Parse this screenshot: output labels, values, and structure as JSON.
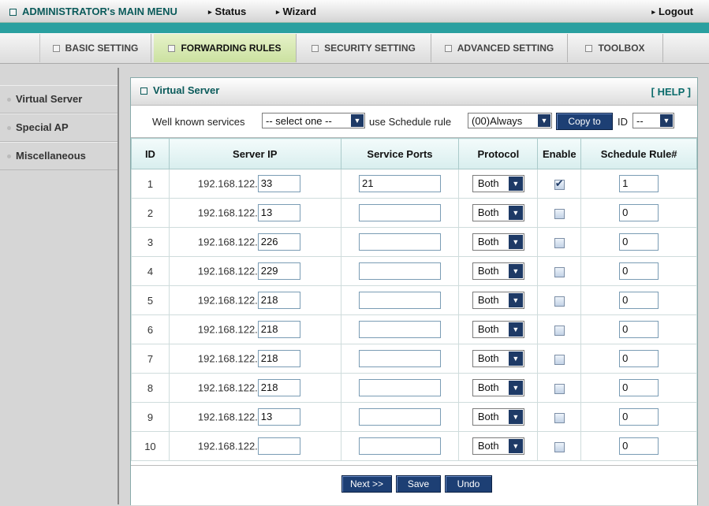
{
  "topbar": {
    "admin_title": "ADMINISTRATOR's MAIN MENU",
    "status": "Status",
    "wizard": "Wizard",
    "logout": "Logout"
  },
  "tabs": [
    {
      "label": "BASIC SETTING"
    },
    {
      "label": "FORWARDING RULES",
      "active": true
    },
    {
      "label": "SECURITY SETTING"
    },
    {
      "label": "ADVANCED SETTING"
    },
    {
      "label": "TOOLBOX"
    }
  ],
  "sidebar": {
    "items": [
      {
        "label": "Virtual Server"
      },
      {
        "label": "Special AP"
      },
      {
        "label": "Miscellaneous"
      }
    ]
  },
  "panel": {
    "title": "Virtual Server",
    "help": "[ HELP ]"
  },
  "controls": {
    "well_known_label": "Well known services",
    "well_known_value": "-- select one --",
    "schedule_label": "use Schedule rule",
    "schedule_value": "(00)Always",
    "copy_to": "Copy to",
    "id_label": "ID",
    "id_value": "--"
  },
  "table": {
    "headers": [
      "ID",
      "Server IP",
      "Service Ports",
      "Protocol",
      "Enable",
      "Schedule Rule#"
    ],
    "ip_prefix": "192.168.122.",
    "rows": [
      {
        "id": "1",
        "ip": "33",
        "ports": "21",
        "protocol": "Both",
        "enabled": true,
        "schedule": "1"
      },
      {
        "id": "2",
        "ip": "13",
        "ports": "",
        "protocol": "Both",
        "enabled": false,
        "schedule": "0"
      },
      {
        "id": "3",
        "ip": "226",
        "ports": "",
        "protocol": "Both",
        "enabled": false,
        "schedule": "0"
      },
      {
        "id": "4",
        "ip": "229",
        "ports": "",
        "protocol": "Both",
        "enabled": false,
        "schedule": "0"
      },
      {
        "id": "5",
        "ip": "218",
        "ports": "",
        "protocol": "Both",
        "enabled": false,
        "schedule": "0"
      },
      {
        "id": "6",
        "ip": "218",
        "ports": "",
        "protocol": "Both",
        "enabled": false,
        "schedule": "0"
      },
      {
        "id": "7",
        "ip": "218",
        "ports": "",
        "protocol": "Both",
        "enabled": false,
        "schedule": "0"
      },
      {
        "id": "8",
        "ip": "218",
        "ports": "",
        "protocol": "Both",
        "enabled": false,
        "schedule": "0"
      },
      {
        "id": "9",
        "ip": "13",
        "ports": "",
        "protocol": "Both",
        "enabled": false,
        "schedule": "0"
      },
      {
        "id": "10",
        "ip": "",
        "ports": "",
        "protocol": "Both",
        "enabled": false,
        "schedule": "0"
      }
    ]
  },
  "footer": {
    "next": "Next >>",
    "save": "Save",
    "undo": "Undo"
  },
  "colors": {
    "teal_bar": "#2aa0a0",
    "active_tab": "#cbe1a0",
    "button_navy": "#1d3f74",
    "title_teal": "#0a5a5a"
  }
}
